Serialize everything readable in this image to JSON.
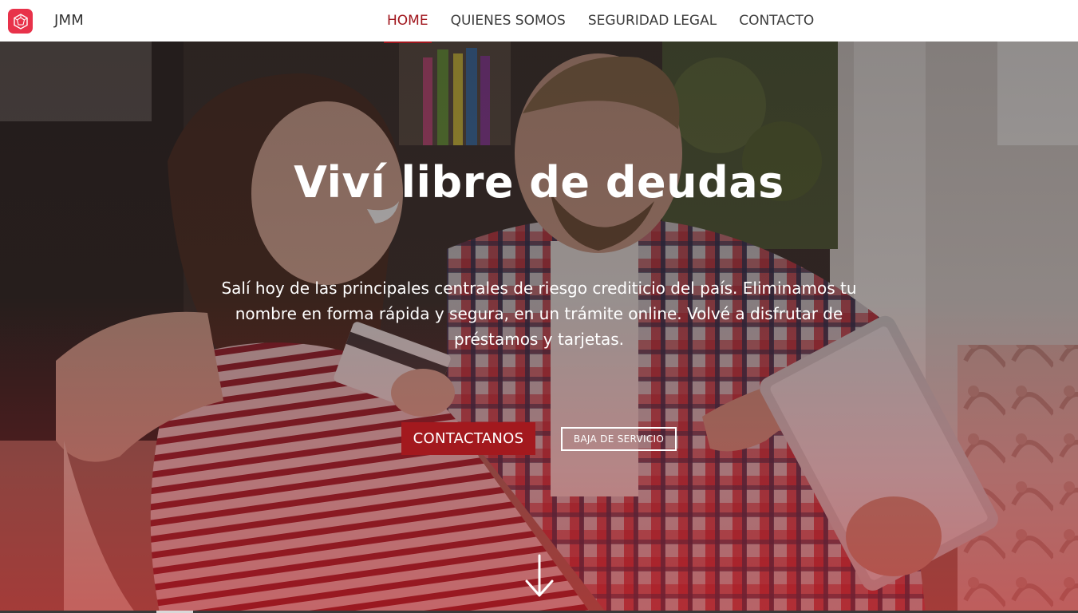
{
  "header": {
    "brand": "JMM",
    "logo_icon": "geometric-logo-icon",
    "nav": [
      {
        "label": "HOME",
        "active": true
      },
      {
        "label": "QUIENES SOMOS",
        "active": false
      },
      {
        "label": "SEGURIDAD LEGAL",
        "active": false
      },
      {
        "label": "CONTACTO",
        "active": false
      }
    ]
  },
  "hero": {
    "title": "Viví libre de deudas",
    "text": "Salí hoy de las principales centrales de riesgo crediticio del país. Eliminamos tu nombre en forma rápida y segura, en un trámite online. Volvé a disfrutar de préstamos y tarjetas.",
    "primary_button": "CONTACTANOS",
    "secondary_button": "BAJA DE SERVICIO",
    "scroll_icon": "arrow-down-icon"
  },
  "colors": {
    "accent": "#a3191e",
    "logo": "#e8324a",
    "nav_text": "#3c3c3c"
  }
}
